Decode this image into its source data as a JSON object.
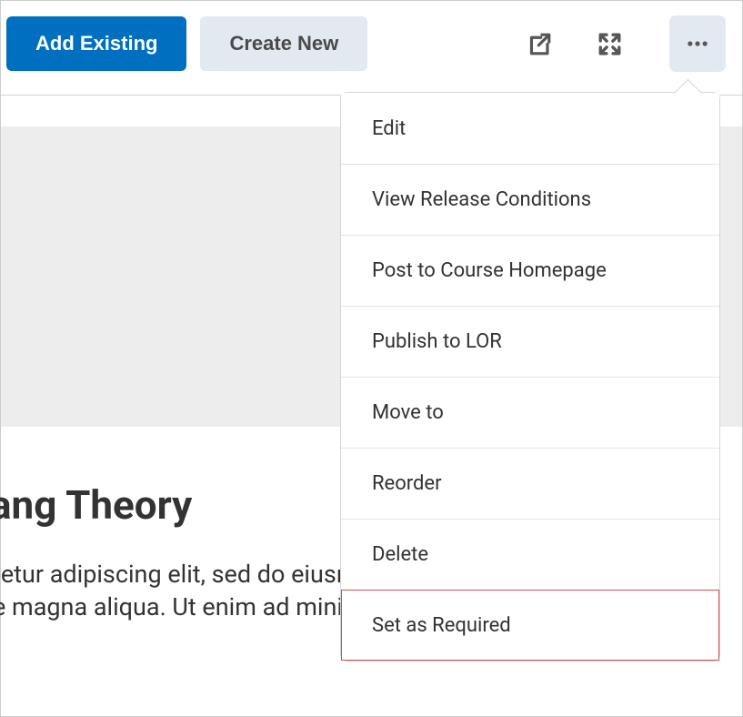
{
  "toolbar": {
    "add_existing_label": "Add Existing",
    "create_new_label": "Create New"
  },
  "menu": {
    "items": [
      {
        "label": "Edit",
        "highlight": false
      },
      {
        "label": "View Release Conditions",
        "highlight": false
      },
      {
        "label": "Post to Course Homepage",
        "highlight": false
      },
      {
        "label": "Publish to LOR",
        "highlight": false
      },
      {
        "label": "Move to",
        "highlight": false
      },
      {
        "label": "Reorder",
        "highlight": false
      },
      {
        "label": "Delete",
        "highlight": false
      },
      {
        "label": "Set as Required",
        "highlight": true
      }
    ]
  },
  "content": {
    "title_fragment": "ang Theory",
    "body_line1_fragment": "tetur adipiscing elit, sed do eiusmod tempor",
    "body_line2_fragment": "e magna aliqua. Ut enim ad minim"
  }
}
